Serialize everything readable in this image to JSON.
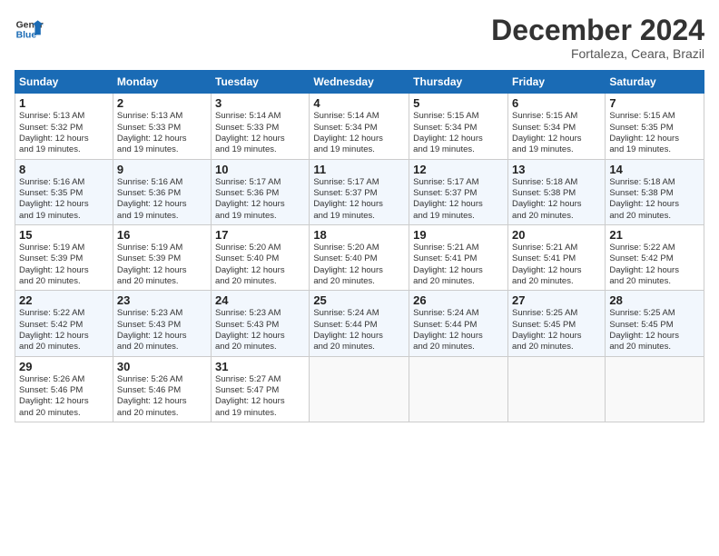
{
  "logo": {
    "line1": "General",
    "line2": "Blue"
  },
  "title": "December 2024",
  "subtitle": "Fortaleza, Ceara, Brazil",
  "weekdays": [
    "Sunday",
    "Monday",
    "Tuesday",
    "Wednesday",
    "Thursday",
    "Friday",
    "Saturday"
  ],
  "weeks": [
    [
      {
        "day": "1",
        "sunrise": "5:13 AM",
        "sunset": "5:32 PM",
        "daylight": "12 hours and 19 minutes."
      },
      {
        "day": "2",
        "sunrise": "5:13 AM",
        "sunset": "5:33 PM",
        "daylight": "12 hours and 19 minutes."
      },
      {
        "day": "3",
        "sunrise": "5:14 AM",
        "sunset": "5:33 PM",
        "daylight": "12 hours and 19 minutes."
      },
      {
        "day": "4",
        "sunrise": "5:14 AM",
        "sunset": "5:34 PM",
        "daylight": "12 hours and 19 minutes."
      },
      {
        "day": "5",
        "sunrise": "5:15 AM",
        "sunset": "5:34 PM",
        "daylight": "12 hours and 19 minutes."
      },
      {
        "day": "6",
        "sunrise": "5:15 AM",
        "sunset": "5:34 PM",
        "daylight": "12 hours and 19 minutes."
      },
      {
        "day": "7",
        "sunrise": "5:15 AM",
        "sunset": "5:35 PM",
        "daylight": "12 hours and 19 minutes."
      }
    ],
    [
      {
        "day": "8",
        "sunrise": "5:16 AM",
        "sunset": "5:35 PM",
        "daylight": "12 hours and 19 minutes."
      },
      {
        "day": "9",
        "sunrise": "5:16 AM",
        "sunset": "5:36 PM",
        "daylight": "12 hours and 19 minutes."
      },
      {
        "day": "10",
        "sunrise": "5:17 AM",
        "sunset": "5:36 PM",
        "daylight": "12 hours and 19 minutes."
      },
      {
        "day": "11",
        "sunrise": "5:17 AM",
        "sunset": "5:37 PM",
        "daylight": "12 hours and 19 minutes."
      },
      {
        "day": "12",
        "sunrise": "5:17 AM",
        "sunset": "5:37 PM",
        "daylight": "12 hours and 19 minutes."
      },
      {
        "day": "13",
        "sunrise": "5:18 AM",
        "sunset": "5:38 PM",
        "daylight": "12 hours and 20 minutes."
      },
      {
        "day": "14",
        "sunrise": "5:18 AM",
        "sunset": "5:38 PM",
        "daylight": "12 hours and 20 minutes."
      }
    ],
    [
      {
        "day": "15",
        "sunrise": "5:19 AM",
        "sunset": "5:39 PM",
        "daylight": "12 hours and 20 minutes."
      },
      {
        "day": "16",
        "sunrise": "5:19 AM",
        "sunset": "5:39 PM",
        "daylight": "12 hours and 20 minutes."
      },
      {
        "day": "17",
        "sunrise": "5:20 AM",
        "sunset": "5:40 PM",
        "daylight": "12 hours and 20 minutes."
      },
      {
        "day": "18",
        "sunrise": "5:20 AM",
        "sunset": "5:40 PM",
        "daylight": "12 hours and 20 minutes."
      },
      {
        "day": "19",
        "sunrise": "5:21 AM",
        "sunset": "5:41 PM",
        "daylight": "12 hours and 20 minutes."
      },
      {
        "day": "20",
        "sunrise": "5:21 AM",
        "sunset": "5:41 PM",
        "daylight": "12 hours and 20 minutes."
      },
      {
        "day": "21",
        "sunrise": "5:22 AM",
        "sunset": "5:42 PM",
        "daylight": "12 hours and 20 minutes."
      }
    ],
    [
      {
        "day": "22",
        "sunrise": "5:22 AM",
        "sunset": "5:42 PM",
        "daylight": "12 hours and 20 minutes."
      },
      {
        "day": "23",
        "sunrise": "5:23 AM",
        "sunset": "5:43 PM",
        "daylight": "12 hours and 20 minutes."
      },
      {
        "day": "24",
        "sunrise": "5:23 AM",
        "sunset": "5:43 PM",
        "daylight": "12 hours and 20 minutes."
      },
      {
        "day": "25",
        "sunrise": "5:24 AM",
        "sunset": "5:44 PM",
        "daylight": "12 hours and 20 minutes."
      },
      {
        "day": "26",
        "sunrise": "5:24 AM",
        "sunset": "5:44 PM",
        "daylight": "12 hours and 20 minutes."
      },
      {
        "day": "27",
        "sunrise": "5:25 AM",
        "sunset": "5:45 PM",
        "daylight": "12 hours and 20 minutes."
      },
      {
        "day": "28",
        "sunrise": "5:25 AM",
        "sunset": "5:45 PM",
        "daylight": "12 hours and 20 minutes."
      }
    ],
    [
      {
        "day": "29",
        "sunrise": "5:26 AM",
        "sunset": "5:46 PM",
        "daylight": "12 hours and 20 minutes."
      },
      {
        "day": "30",
        "sunrise": "5:26 AM",
        "sunset": "5:46 PM",
        "daylight": "12 hours and 20 minutes."
      },
      {
        "day": "31",
        "sunrise": "5:27 AM",
        "sunset": "5:47 PM",
        "daylight": "12 hours and 19 minutes."
      },
      null,
      null,
      null,
      null
    ]
  ]
}
